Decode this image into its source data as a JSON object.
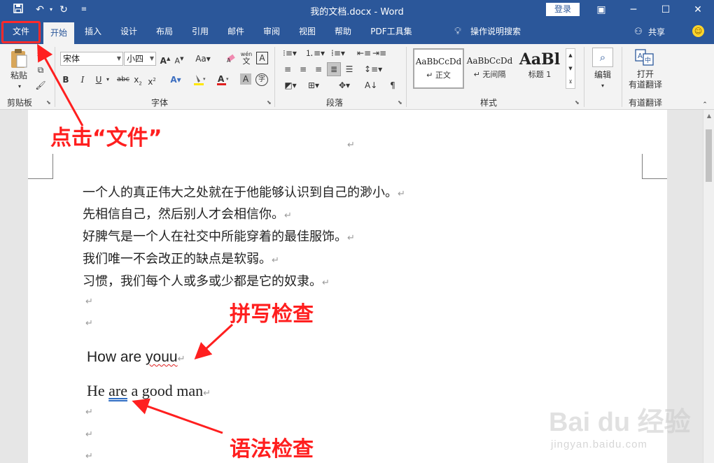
{
  "titlebar": {
    "title": "我的文档.docx  -  Word",
    "login_label": "登录",
    "quick_access": [
      "save-icon",
      "undo-icon",
      "redo-icon",
      "customize-icon"
    ],
    "color": "#2b579a"
  },
  "tabs": [
    {
      "label": "文件"
    },
    {
      "label": "开始"
    },
    {
      "label": "插入"
    },
    {
      "label": "设计"
    },
    {
      "label": "布局"
    },
    {
      "label": "引用"
    },
    {
      "label": "邮件"
    },
    {
      "label": "审阅"
    },
    {
      "label": "视图"
    },
    {
      "label": "帮助"
    },
    {
      "label": "PDF工具集"
    }
  ],
  "tell_me": "操作说明搜索",
  "share_label": "共享",
  "ribbon": {
    "clipboard": {
      "paste_label": "粘贴",
      "group_label": "剪贴板"
    },
    "font": {
      "font_name": "宋体",
      "font_size": "小四",
      "group_label": "字体"
    },
    "paragraph": {
      "group_label": "段落"
    },
    "styles": {
      "group_label": "样式",
      "items": [
        {
          "sample": "AaBbCcDd",
          "name": "↵ 正文"
        },
        {
          "sample": "AaBbCcDd",
          "name": "↵ 无间隔"
        },
        {
          "sample": "AaBl",
          "name": "标题 1"
        }
      ]
    },
    "editing": {
      "label": "编辑"
    },
    "translate": {
      "label_line1": "打开",
      "label_line2": "有道翻译",
      "group_label": "有道翻译"
    }
  },
  "document": {
    "pilcrow": "↵",
    "lines": [
      "一个人的真正伟大之处就在于他能够认识到自己的渺小。",
      "先相信自己，然后别人才会相信你。",
      "好脾气是一个人在社交中所能穿着的最佳服饰。",
      "我们唯一不会改正的缺点是软弱。",
      "习惯，我们每个人或多或少都是它的奴隶。"
    ],
    "english1": {
      "before": "How are ",
      "error": "youu"
    },
    "english2": {
      "before": "He ",
      "error": "are",
      "after": " a good man"
    }
  },
  "annotations": {
    "click_file": "点击“文件”",
    "spell_check": "拼写检查",
    "grammar_check": "语法检查",
    "color": "#ff1f1f"
  },
  "watermark": {
    "main": "Bai du 经验",
    "sub": "jingyan.baidu.com"
  }
}
